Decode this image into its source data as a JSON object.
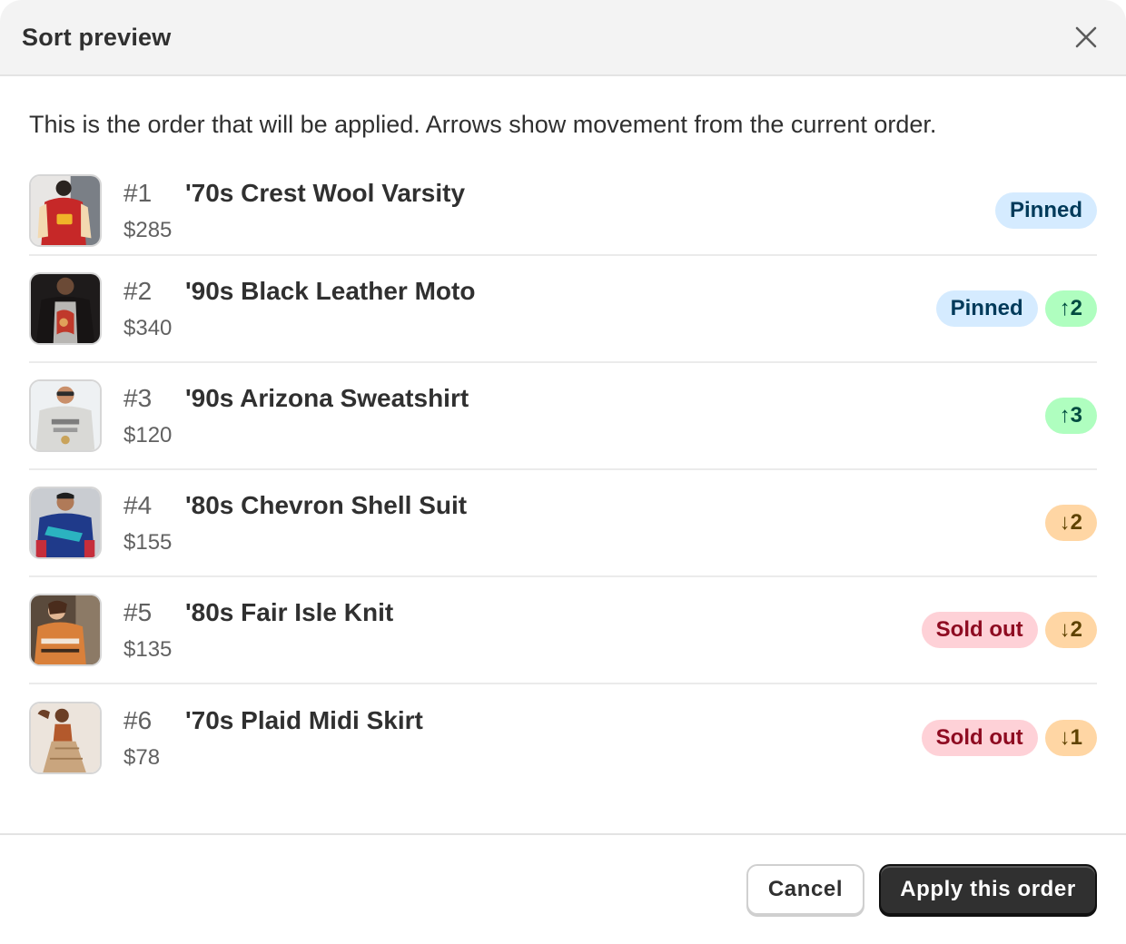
{
  "modal": {
    "title": "Sort preview",
    "intro": "This is the order that will be applied. Arrows show movement from the current order."
  },
  "icons": {
    "close": "close-icon"
  },
  "items": [
    {
      "rank": "#1",
      "name": "'70s Crest Wool Varsity",
      "price": "$285",
      "badges": [
        "Pinned"
      ],
      "thumb": "varsity-jacket-photo"
    },
    {
      "rank": "#2",
      "name": "'90s Black Leather Moto",
      "price": "$340",
      "badges": [
        "Pinned",
        "↑2"
      ],
      "thumb": "leather-moto-photo"
    },
    {
      "rank": "#3",
      "name": "'90s Arizona Sweatshirt",
      "price": "$120",
      "badges": [
        "↑3"
      ],
      "thumb": "arizona-sweatshirt-photo"
    },
    {
      "rank": "#4",
      "name": "'80s Chevron Shell Suit",
      "price": "$155",
      "badges": [
        "↓2"
      ],
      "thumb": "shell-suit-photo"
    },
    {
      "rank": "#5",
      "name": "'80s Fair Isle Knit",
      "price": "$135",
      "badges": [
        "Sold out",
        "↓2"
      ],
      "thumb": "fair-isle-knit-photo"
    },
    {
      "rank": "#6",
      "name": "'70s Plaid Midi Skirt",
      "price": "$78",
      "badges": [
        "Sold out",
        "↓1"
      ],
      "thumb": "plaid-skirt-photo"
    }
  ],
  "footer": {
    "cancel_label": "Cancel",
    "apply_label": "Apply this order"
  },
  "colors": {
    "pinned_bg": "#d5ebff",
    "up_bg": "#affebf",
    "down_bg": "#ffd6a4",
    "soldout_bg": "#fed1d7",
    "primary_button": "#303030"
  }
}
